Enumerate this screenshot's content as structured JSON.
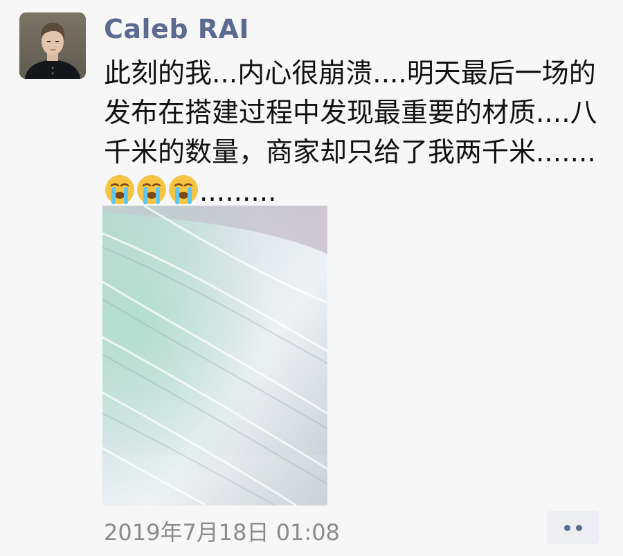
{
  "post": {
    "username": "Caleb RAI",
    "text_before_emoji": "此刻的我...内心很崩溃....明天最后一场的发布在搭建过程中发现最重要的材质....八千米的数量，商家却只给了我两千米.......",
    "text_after_emoji": ".........",
    "emojis": [
      "crying-emoji",
      "crying-emoji",
      "crying-emoji"
    ],
    "photo_count": 1,
    "timestamp": "2019年7月18日 01:08"
  },
  "colors": {
    "username": "#5b6a91",
    "timestamp": "#8a8a8a",
    "more_button_bg": "#eceef1",
    "page_bg": "#f7f7f7"
  },
  "icons": {
    "avatar": "profile-photo",
    "more": "more-dots-icon"
  }
}
